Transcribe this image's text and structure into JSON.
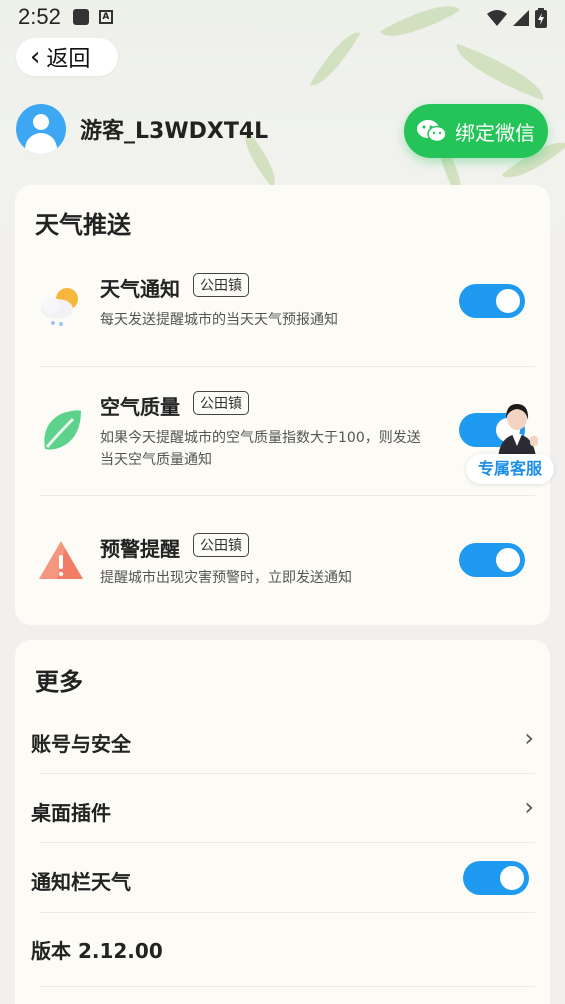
{
  "status_bar": {
    "time": "2:52"
  },
  "header": {
    "back_label": "返回"
  },
  "profile": {
    "username": "游客_L3WDXT4L",
    "wechat_button": "绑定微信"
  },
  "weather_push": {
    "title": "天气推送",
    "items": [
      {
        "name": "天气通知",
        "tag": "公田镇",
        "desc_lines": [
          "每天发送提醒城市的当天天气预报通知"
        ],
        "enabled": true,
        "icon": "weather-cloud-sun-icon"
      },
      {
        "name": "空气质量",
        "tag": "公田镇",
        "desc_lines": [
          "如果今天提醒城市的空气质量指数大于100，则发送",
          "当天空气质量通知"
        ],
        "enabled": true,
        "icon": "leaf-icon"
      },
      {
        "name": "预警提醒",
        "tag": "公田镇",
        "desc_lines": [
          "提醒城市出现灾害预警时，立即发送通知"
        ],
        "enabled": true,
        "icon": "warning-icon"
      }
    ]
  },
  "customer_service": {
    "label": "专属客服"
  },
  "more": {
    "title": "更多",
    "rows": [
      {
        "label": "账号与安全",
        "type": "link"
      },
      {
        "label": "桌面插件",
        "type": "link"
      },
      {
        "label": "通知栏天气",
        "type": "toggle",
        "enabled": true
      },
      {
        "label": "版本 2.12.00",
        "type": "static"
      }
    ]
  },
  "colors": {
    "accent": "#1e9bf0",
    "wechat": "#24c459"
  }
}
